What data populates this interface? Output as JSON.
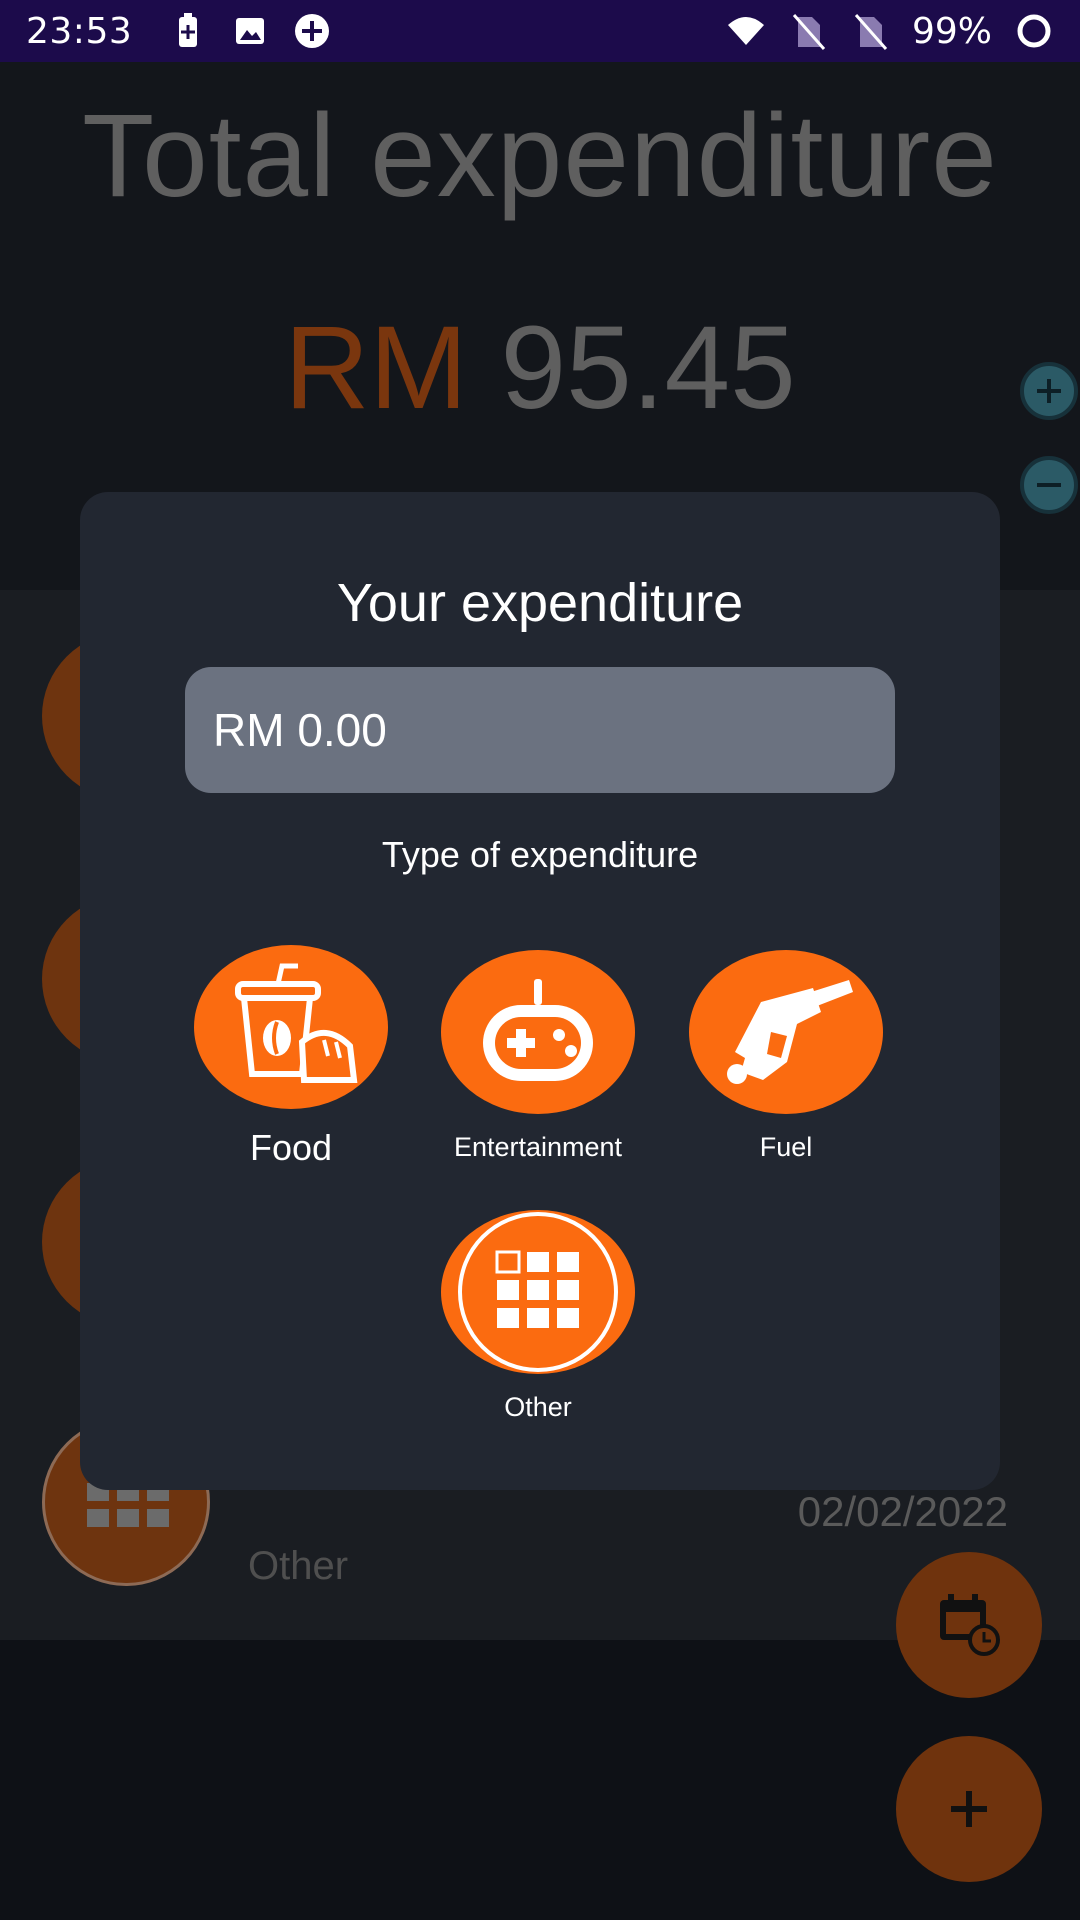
{
  "status_bar": {
    "time": "23:53",
    "battery": "99%"
  },
  "background": {
    "title": "Total expenditure",
    "currency": "RM",
    "total": "95.45",
    "list": [
      {
        "date": "02/02/2022",
        "category": "Other"
      }
    ]
  },
  "dialog": {
    "title": "Your expenditure",
    "amount_value": "RM 0.00",
    "type_label": "Type of expenditure",
    "categories": [
      {
        "label": "Food",
        "icon": "food-icon"
      },
      {
        "label": "Entertainment",
        "icon": "gamepad-icon"
      },
      {
        "label": "Fuel",
        "icon": "fuel-nozzle-icon"
      },
      {
        "label": "Other",
        "icon": "grid-icon"
      }
    ]
  },
  "colors": {
    "accent": "#fb6b10",
    "dialog_bg": "#222731",
    "status_bar": "#1c0b4b"
  }
}
